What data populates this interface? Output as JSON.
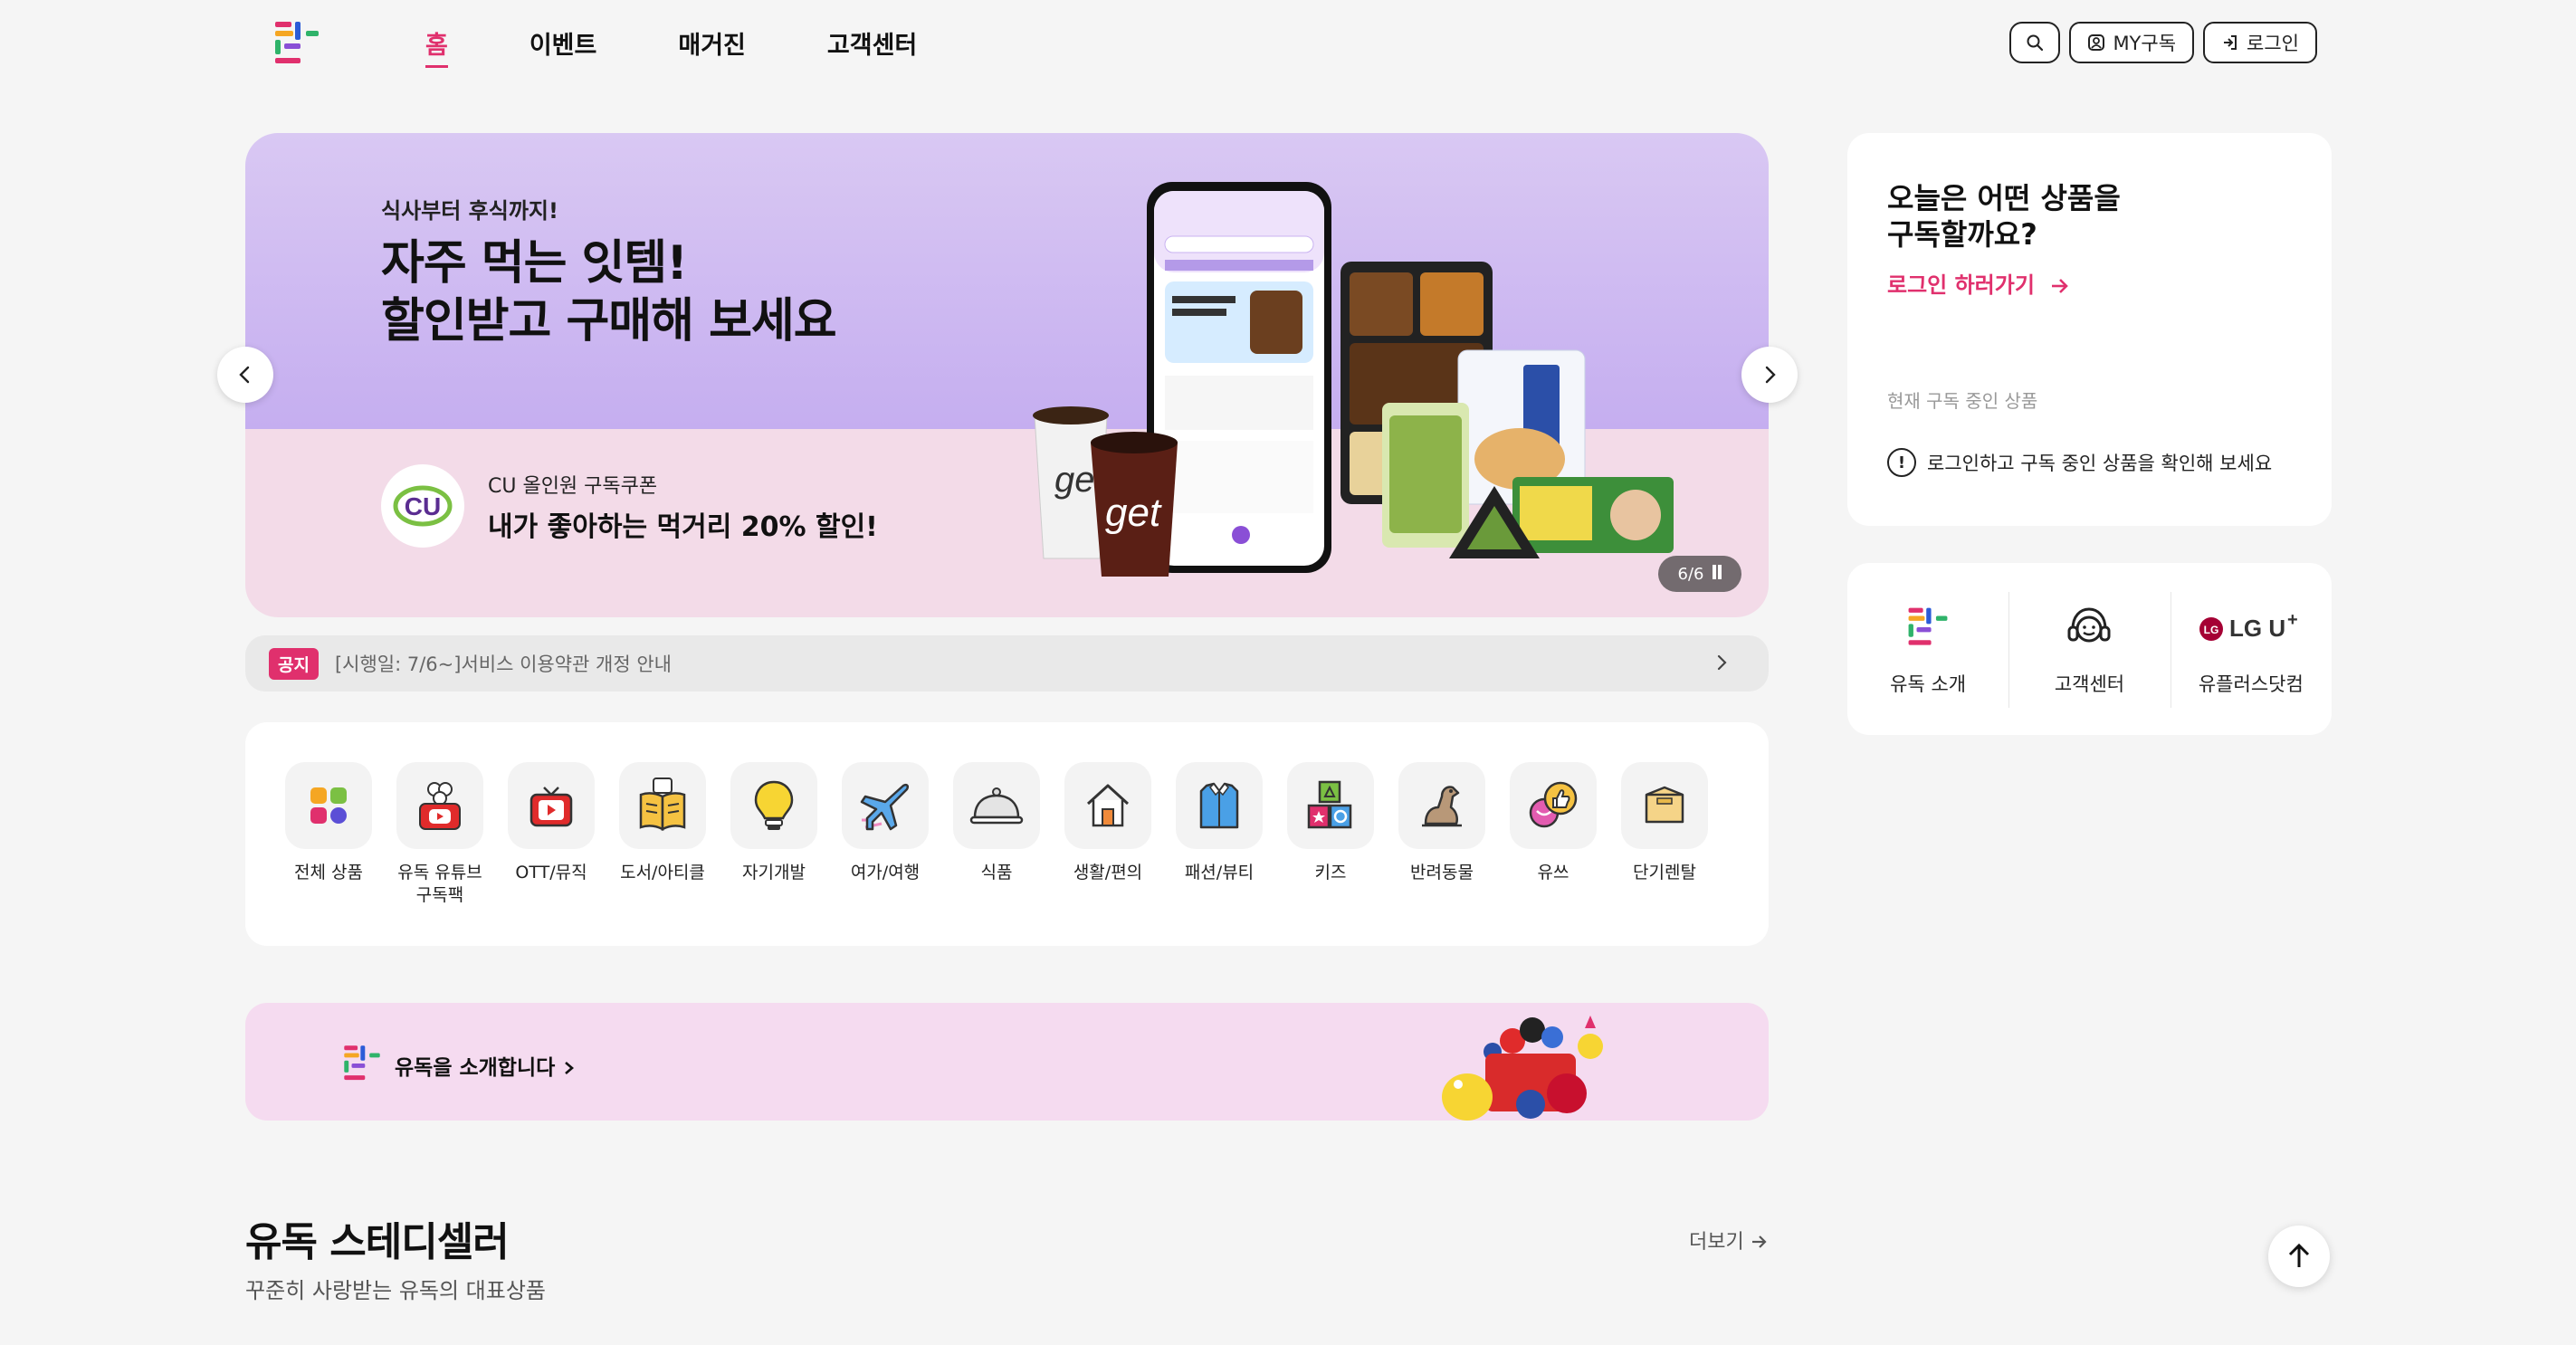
{
  "nav": {
    "items": [
      "홈",
      "이벤트",
      "매거진",
      "고객센터"
    ],
    "active": "홈"
  },
  "header_buttons": {
    "search_icon": "search-icon",
    "my_label": "MY구독",
    "login_label": "로그인"
  },
  "hero": {
    "eyebrow": "식사부터 후식까지!",
    "title_line1": "자주 먹는 잇템!",
    "title_line2": "할인받고 구매해 보세요",
    "coupon_sub": "CU 올인원 구독쿠폰",
    "coupon_main": "내가 좋아하는 먹거리 20% 할인!",
    "badge_text": "CU",
    "cup_text": "get",
    "counter": "6/6"
  },
  "notice": {
    "tag": "공지",
    "text": "[시행일: 7/6~]서비스 이용약관 개정 안내"
  },
  "categories": [
    {
      "label": "전체 상품",
      "icon": "grid-icon"
    },
    {
      "label": "유독 유튜브\n구독팩",
      "icon": "youtube-pack-icon"
    },
    {
      "label": "OTT/뮤직",
      "icon": "tv-icon"
    },
    {
      "label": "도서/아티클",
      "icon": "book-icon"
    },
    {
      "label": "자기개발",
      "icon": "lightbulb-icon"
    },
    {
      "label": "여가/여행",
      "icon": "airplane-icon"
    },
    {
      "label": "식품",
      "icon": "cloche-icon"
    },
    {
      "label": "생활/편의",
      "icon": "house-icon"
    },
    {
      "label": "패션/뷰티",
      "icon": "shirt-icon"
    },
    {
      "label": "키즈",
      "icon": "blocks-icon"
    },
    {
      "label": "반려동물",
      "icon": "dog-icon"
    },
    {
      "label": "유쓰",
      "icon": "thumbs-up-icon"
    },
    {
      "label": "단기렌탈",
      "icon": "box-icon"
    }
  ],
  "intro": {
    "text": "유독을 소개합니다"
  },
  "steady": {
    "title": "유독 스테디셀러",
    "subtitle": "꾸준히 사랑받는 유독의 대표상품",
    "more": "더보기"
  },
  "login_card": {
    "title_line1": "오늘은 어떤 상품을",
    "title_line2": "구독할까요?",
    "link": "로그인 하러가기",
    "current_label": "현재 구독 중인 상품",
    "info": "로그인하고 구독 중인 상품을 확인해 보세요"
  },
  "links": [
    {
      "label": "유독 소개",
      "icon": "udok-logo-icon"
    },
    {
      "label": "고객센터",
      "icon": "headset-icon"
    },
    {
      "label": "유플러스닷컴",
      "icon": "lgu-logo-icon",
      "logo_text": "LG U",
      "logo_sup": "+"
    }
  ],
  "colors": {
    "accent": "#e0306d",
    "background": "#f5f5f5",
    "hero_top": "#c9b3f1",
    "hero_bottom": "#f3dbe8",
    "intro_bg": "#f5dbf0"
  }
}
